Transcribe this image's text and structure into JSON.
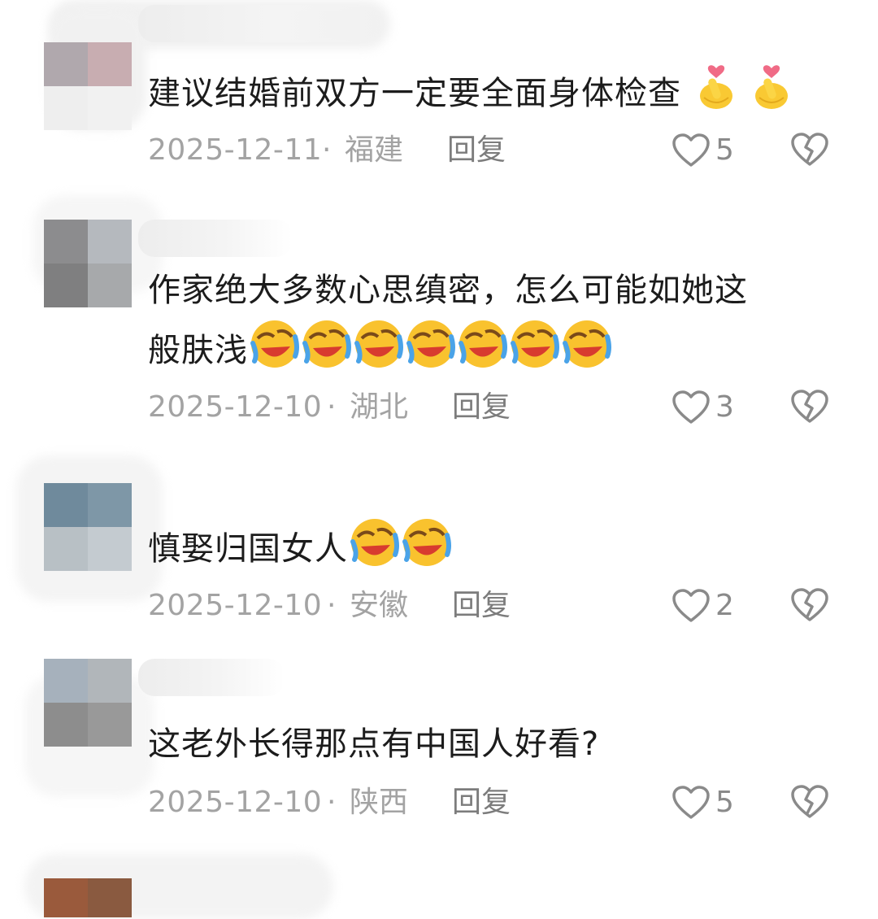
{
  "comments": [
    {
      "text_lines": [
        "建议结婚前双方一定要全面身体检查"
      ],
      "trailing_emoji": [
        "finger-heart",
        "finger-heart"
      ],
      "date": "2025-12-11",
      "separator": "·",
      "location": "福建",
      "reply_label": "回复",
      "likes": "5",
      "avatar_colors": [
        "#b0a8ad",
        "#bdb2b6",
        "#a99ba0",
        "#c8adb1"
      ]
    },
    {
      "text_lines": [
        "作家绝大多数心思缜密，怎么可能如她这",
        "般肤浅"
      ],
      "trailing_emoji": [
        "rofl",
        "rofl",
        "rofl",
        "rofl",
        "rofl",
        "rofl",
        "rofl"
      ],
      "date": "2025-12-10",
      "separator": "·",
      "location": "湖北",
      "reply_label": "回复",
      "likes": "3",
      "avatar_colors": [
        "#8c8c8e",
        "#b5b9be",
        "#7f7f80",
        "#a7a9ab"
      ]
    },
    {
      "text_lines": [
        "慎娶归国女人"
      ],
      "trailing_emoji": [
        "rofl",
        "rofl"
      ],
      "date": "2025-12-10",
      "separator": "·",
      "location": "安徽",
      "reply_label": "回复",
      "likes": "2",
      "avatar_colors": [
        "#6f8a9c",
        "#7e97a7",
        "#b8c0c5",
        "#c4cbd0"
      ]
    },
    {
      "text_lines": [
        "这老外长得那点有中国人好看?"
      ],
      "trailing_emoji": [],
      "date": "2025-12-10",
      "separator": "·",
      "location": "陕西",
      "reply_label": "回复",
      "likes": "5",
      "avatar_colors": [
        "#a6b1bc",
        "#b1b6ba",
        "#8d8d8d",
        "#999999"
      ]
    }
  ],
  "partial_avatar_colors": [
    "#9a5a3c",
    "#8a5a40"
  ],
  "icons": {
    "like": "heart-outline-icon",
    "dislike": "broken-heart-icon"
  },
  "colors": {
    "text": "#1c1c1c",
    "meta": "#a3a3a3",
    "reply": "#7c7c7c",
    "icon": "#8a8a8a"
  }
}
